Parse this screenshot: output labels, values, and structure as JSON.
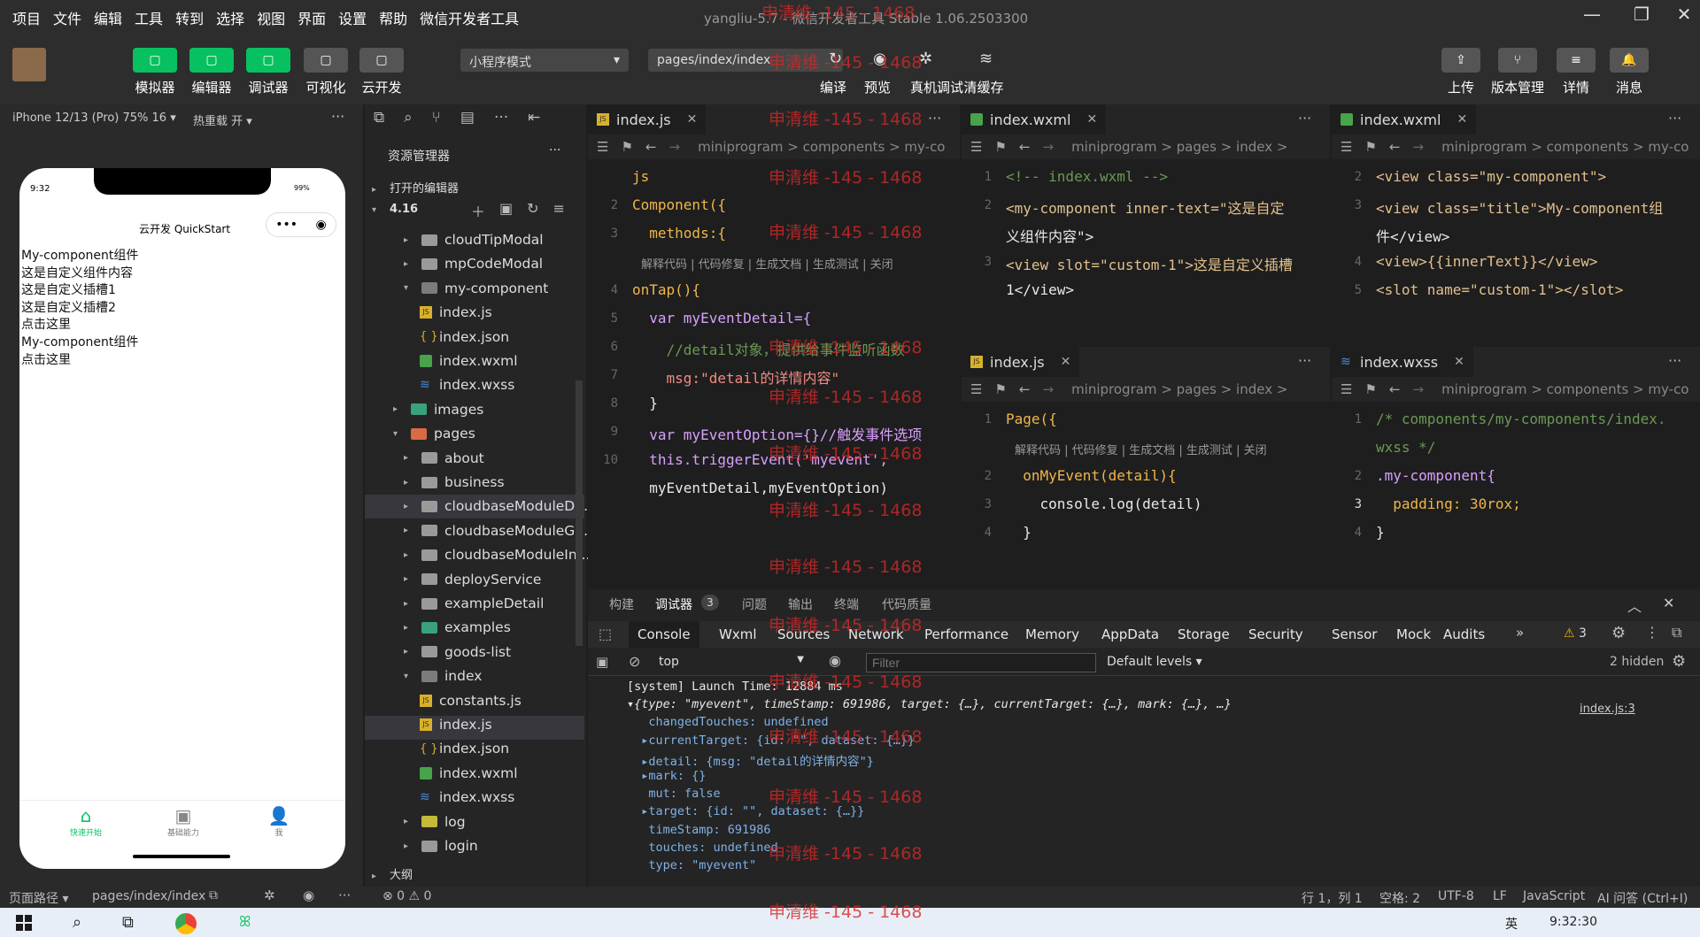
{
  "menubar": {
    "items": [
      "项目",
      "文件",
      "编辑",
      "工具",
      "转到",
      "选择",
      "视图",
      "界面",
      "设置",
      "帮助",
      "微信开发者工具"
    ],
    "title": "yangliu-5.7 - 微信开发者工具 Stable 1.06.2503300"
  },
  "toolbar": {
    "left_buttons": [
      {
        "label": "模拟器",
        "icon": "phone-icon",
        "color": "#07c160"
      },
      {
        "label": "编辑器",
        "icon": "code-icon",
        "color": "#07c160"
      },
      {
        "label": "调试器",
        "icon": "debug-icon",
        "color": "#07c160"
      },
      {
        "label": "可视化",
        "icon": "layout-icon",
        "color": "#555555"
      },
      {
        "label": "云开发",
        "icon": "cloud-icon",
        "color": "#555555"
      }
    ],
    "mode_select": "小程序模式",
    "path_select": "pages/index/index",
    "mid_buttons": [
      "编译",
      "预览",
      "真机调试",
      "清缓存"
    ],
    "right_buttons": [
      "上传",
      "版本管理",
      "详情",
      "消息"
    ]
  },
  "simulator": {
    "device": "iPhone 12/13 (Pro) 75% 16 ▾",
    "hotreload": "热重载 开 ▾",
    "time": "9:32",
    "battery": "99%",
    "nav_title": "云开发 QuickStart",
    "lines": [
      "My-component组件",
      "这是自定义组件内容",
      "这是自定义插槽1",
      "这是自定义插槽2",
      "点击这里",
      "My-component组件",
      "点击这里"
    ],
    "tabbar": [
      {
        "label": "快速开始",
        "icon": "home-icon"
      },
      {
        "label": "基础能力",
        "icon": "terminal-icon"
      },
      {
        "label": "我",
        "icon": "user-icon"
      }
    ]
  },
  "explorer": {
    "title": "资源管理器",
    "open_editors": "打开的编辑器",
    "root": "4.16",
    "outline": "大纲",
    "items": [
      {
        "label": "cloudTipModal",
        "type": "folder",
        "depth": 2
      },
      {
        "label": "mpCodeModal",
        "type": "folder",
        "depth": 2
      },
      {
        "label": "my-component",
        "type": "folder-open",
        "depth": 2
      },
      {
        "label": "index.js",
        "type": "js",
        "depth": 3
      },
      {
        "label": "index.json",
        "type": "json",
        "depth": 3
      },
      {
        "label": "index.wxml",
        "type": "wxml",
        "depth": 3
      },
      {
        "label": "index.wxss",
        "type": "wxss",
        "depth": 3
      },
      {
        "label": "images",
        "type": "folder",
        "depth": 1
      },
      {
        "label": "pages",
        "type": "folder-open",
        "depth": 1
      },
      {
        "label": "about",
        "type": "folder",
        "depth": 2
      },
      {
        "label": "business",
        "type": "folder",
        "depth": 2
      },
      {
        "label": "cloudbaseModuleD...",
        "type": "folder",
        "depth": 2
      },
      {
        "label": "cloudbaseModuleG...",
        "type": "folder",
        "depth": 2
      },
      {
        "label": "cloudbaseModuleIn...",
        "type": "folder",
        "depth": 2
      },
      {
        "label": "deployService",
        "type": "folder",
        "depth": 2
      },
      {
        "label": "exampleDetail",
        "type": "folder",
        "depth": 2
      },
      {
        "label": "examples",
        "type": "folder",
        "depth": 2
      },
      {
        "label": "goods-list",
        "type": "folder",
        "depth": 2
      },
      {
        "label": "index",
        "type": "folder-open",
        "depth": 2
      },
      {
        "label": "constants.js",
        "type": "js",
        "depth": 3
      },
      {
        "label": "index.js",
        "type": "js",
        "depth": 3
      },
      {
        "label": "index.json",
        "type": "json",
        "depth": 3
      },
      {
        "label": "index.wxml",
        "type": "wxml",
        "depth": 3
      },
      {
        "label": "index.wxss",
        "type": "wxss",
        "depth": 3
      },
      {
        "label": "log",
        "type": "folder",
        "depth": 2
      },
      {
        "label": "login",
        "type": "folder",
        "depth": 2
      }
    ]
  },
  "editor1": {
    "tab": "index.js",
    "breadcrumb": "miniprogram > components > my-co",
    "codelens": "解释代码 | 代码修复 | 生成文档 | 生成测试 | 关闭",
    "lines": [
      {
        "n": "",
        "t": "js"
      },
      {
        "n": "2",
        "t": "Component({"
      },
      {
        "n": "3",
        "t": "  methods:{"
      },
      {
        "n": "",
        "t": ""
      },
      {
        "n": "4",
        "t": "onTap(){"
      },
      {
        "n": "5",
        "t": "  var myEventDetail={"
      },
      {
        "n": "6",
        "t": "    //detail对象，提供给事件监听函数"
      },
      {
        "n": "7",
        "t": "    msg:\"detail的详情内容\""
      },
      {
        "n": "8",
        "t": "  }"
      },
      {
        "n": "9",
        "t": "  var myEventOption={}//触发事件选项"
      },
      {
        "n": "10",
        "t": "  this.triggerEvent('myevent',"
      },
      {
        "n": "",
        "t": "  myEventDetail,myEventOption)"
      }
    ]
  },
  "editor2": {
    "tab": "index.wxml",
    "breadcrumb": "miniprogram > pages > index >",
    "lines": [
      {
        "n": "1",
        "t": "<!-- index.wxml -->"
      },
      {
        "n": "2",
        "t": "<my-component inner-text=\"这是自定"
      },
      {
        "n": "",
        "t": "义组件内容\">"
      },
      {
        "n": "3",
        "t": "<view slot=\"custom-1\">这是自定义插槽"
      },
      {
        "n": "",
        "t": "1</view>"
      }
    ]
  },
  "editor3": {
    "tab": "index.wxml",
    "breadcrumb": "miniprogram > components > my-co",
    "lines": [
      {
        "n": "2",
        "t": "<view class=\"my-component\">"
      },
      {
        "n": "3",
        "t": "<view class=\"title\">My-component组"
      },
      {
        "n": "",
        "t": "件</view>"
      },
      {
        "n": "4",
        "t": "<view>{{innerText}}</view>"
      },
      {
        "n": "5",
        "t": "<slot name=\"custom-1\"></slot>"
      }
    ]
  },
  "editor4": {
    "tab": "index.js",
    "breadcrumb": "miniprogram > pages > index >",
    "codelens": "解释代码 | 代码修复 | 生成文档 | 生成测试 | 关闭",
    "lines": [
      {
        "n": "1",
        "t": "Page({"
      },
      {
        "n": "",
        "t": ""
      },
      {
        "n": "2",
        "t": "  onMyEvent(detail){"
      },
      {
        "n": "3",
        "t": "    console.log(detail)"
      },
      {
        "n": "4",
        "t": "  }"
      }
    ]
  },
  "editor5": {
    "tab": "index.wxss",
    "breadcrumb": "miniprogram > components > my-co",
    "lines": [
      {
        "n": "1",
        "t": "/* components/my-components/index."
      },
      {
        "n": "",
        "t": "wxss */"
      },
      {
        "n": "2",
        "t": ".my-component{"
      },
      {
        "n": "3",
        "t": "  padding: 30rox;"
      },
      {
        "n": "4",
        "t": "}"
      }
    ]
  },
  "bottom": {
    "tabs": [
      "构建",
      "调试器",
      "问题",
      "输出",
      "终端",
      "代码质量"
    ],
    "badge": "3",
    "devtabs": [
      "Console",
      "Wxml",
      "Sources",
      "Network",
      "Performance",
      "Memory",
      "AppData",
      "Storage",
      "Security",
      "Sensor",
      "Mock",
      "Audits"
    ],
    "warn": "3",
    "context": "top",
    "filter": "Filter",
    "levels": "Default levels ▾",
    "hidden": "2 hidden",
    "source": "index.js:3",
    "lines": [
      "[system] Launch Time: 12884 ms",
      "▾{type: \"myevent\", timeStamp: 691986, target: {…}, currentTarget: {…}, mark: {…}, …}",
      "   changedTouches: undefined",
      "  ▸currentTarget: {id: \"\", dataset: {…}}",
      "  ▸detail: {msg: \"detail的详情内容\"}",
      "  ▸mark: {}",
      "   mut: false",
      "  ▸target: {id: \"\", dataset: {…}}",
      "   timeStamp: 691986",
      "   touches: undefined",
      "   type: \"myevent\""
    ]
  },
  "status": {
    "path_label": "页面路径 ▾",
    "path": "pages/index/index",
    "errors": "⊗ 0 ⚠ 0",
    "cursor": "行 1，列 1",
    "spaces": "空格: 2",
    "encoding": "UTF-8",
    "eol": "LF",
    "lang": "JavaScript",
    "ai": "AI 问答  (Ctrl+I)"
  },
  "taskbar": {
    "time": "9:32:30",
    "ime": "英"
  },
  "watermark": "申清维 -145 - 1468"
}
